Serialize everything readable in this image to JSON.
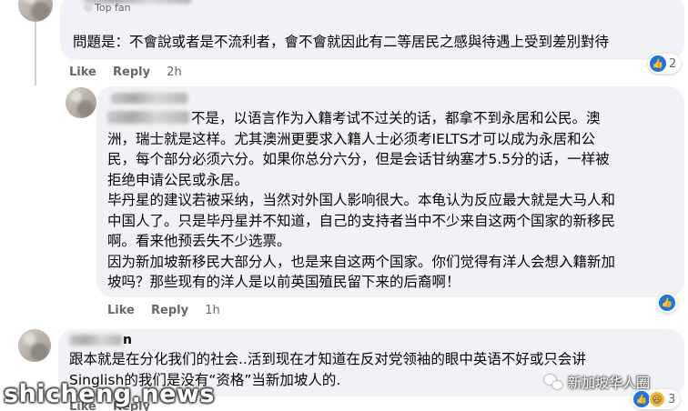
{
  "comments": [
    {
      "badge": "Top fan",
      "text_lines": [
        "問題是：不會說或者是不流利者，會不會就因此有二等居民之感與待遇上受到差別對待"
      ],
      "actions": {
        "like": "Like",
        "reply": "Reply",
        "time": "2h"
      },
      "reactions": {
        "count": "2",
        "icon": "like-icon"
      }
    },
    {
      "text_lines": [
        "不是，以语言作为入籍考试不过关的话，都拿不到永居和公民。澳",
        "洲，瑞士就是这样。尤其澳洲更要求入籍人士必须考IELTS才可以成为永居和公",
        "民，每个部分必须六分。如果你总分六分，但是会话甘纳塞才5.5分的话，一样被",
        "拒绝申请公民或永居。",
        "毕丹星的建议若被采纳，当然对外国人影响很大。本龟认为反应最大就是大马人和",
        "中国人了。只是毕丹星并不知道，自己的支持者当中不少来自这两个国家的新移民",
        "啊。看来他预丢失不少选票。",
        "因为新加坡新移民大部分人，也是来自这两个国家。你们觉得有洋人会想入籍新加",
        "坡吗？那些现有的洋人是以前英国殖民留下来的后裔啊！"
      ],
      "actions": {
        "like": "Like",
        "reply": "Reply",
        "time": "1h"
      },
      "reactions": {
        "count": "",
        "icon": "like-icon"
      }
    },
    {
      "name_suffix": "n",
      "text_lines": [
        "跟本就是在分化我们的社会..活到现在才知道在反对党领袖的眼中英语不好或只会讲",
        "Singlish的我们是没有“资格”当新加坡人的."
      ],
      "actions": {
        "like": "Like",
        "reply": "Reply"
      },
      "reactions": {
        "count": "3",
        "icon": "like-icon",
        "icon2": "haha-icon"
      }
    }
  ],
  "watermarks": {
    "site": "shicheng.news",
    "brand": "新加坡华人圈"
  },
  "colors": {
    "bubble": "#f0f2f5",
    "meta": "#65676b",
    "like_blue": "#1b74e4",
    "text": "#050505"
  }
}
